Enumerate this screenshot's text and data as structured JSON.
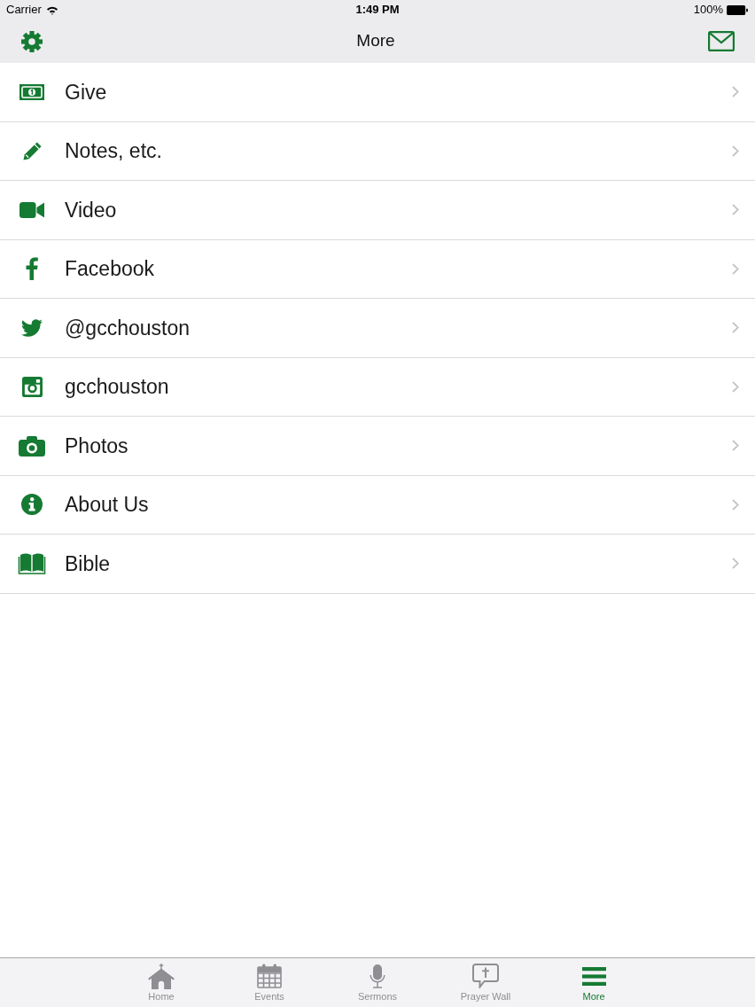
{
  "status_bar": {
    "carrier": "Carrier",
    "time": "1:49 PM",
    "battery": "100%"
  },
  "nav_bar": {
    "title": "More"
  },
  "menu_items": [
    {
      "label": "Give",
      "kind": "money"
    },
    {
      "label": "Notes, etc.",
      "kind": "pencil"
    },
    {
      "label": "Video",
      "kind": "video"
    },
    {
      "label": "Facebook",
      "kind": "facebook"
    },
    {
      "label": "@gcchouston",
      "kind": "twitter"
    },
    {
      "label": "gcchouston",
      "kind": "instagram"
    },
    {
      "label": "Photos",
      "kind": "camera"
    },
    {
      "label": "About Us",
      "kind": "info"
    },
    {
      "label": "Bible",
      "kind": "book"
    }
  ],
  "tab_bar": [
    {
      "label": "Home",
      "kind": "home",
      "selected": false
    },
    {
      "label": "Events",
      "kind": "calendar",
      "selected": false
    },
    {
      "label": "Sermons",
      "kind": "microphone",
      "selected": false
    },
    {
      "label": "Prayer Wall",
      "kind": "bubble",
      "selected": false
    },
    {
      "label": "More",
      "kind": "menu",
      "selected": true
    }
  ]
}
